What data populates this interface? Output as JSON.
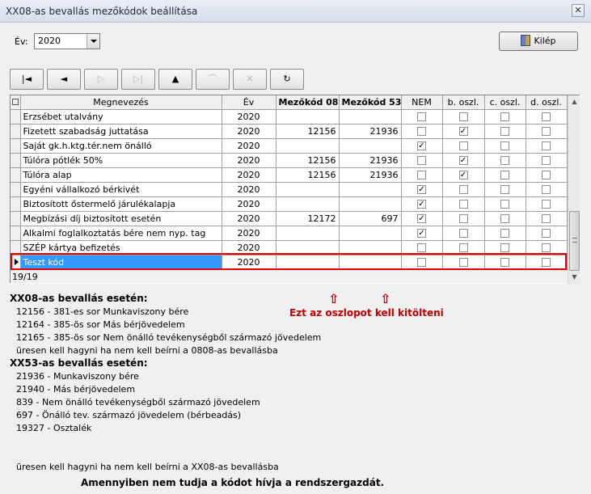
{
  "window": {
    "title": "XX08-as bevallás mezőkódok beállítása",
    "close": "✕"
  },
  "year": {
    "label": "Év:",
    "value": "2020"
  },
  "exit_label": "Kilép",
  "nav": {
    "first": "|◄",
    "prev": "◄",
    "next": "▷",
    "last": "▷|",
    "insert": "▲",
    "edit": "⌒",
    "cancel": "✕",
    "refresh": "↻"
  },
  "table": {
    "headers": [
      "Megnevezés",
      "Év",
      "Mezőkód 08",
      "Mezőkód 53",
      "NEM",
      "b. oszl.",
      "c. oszl.",
      "d. oszl."
    ],
    "rows": [
      {
        "name": "Erzsébet utalvány",
        "year": "2020",
        "c08": "",
        "c53": "",
        "nem": "",
        "b": "",
        "c": "",
        "d": ""
      },
      {
        "name": "Fizetett szabadság juttatása",
        "year": "2020",
        "c08": "12156",
        "c53": "21936",
        "nem": "",
        "b": "✓",
        "c": "",
        "d": ""
      },
      {
        "name": "Saját gk.h.ktg.tér.nem önálló",
        "year": "2020",
        "c08": "",
        "c53": "",
        "nem": "✓",
        "b": "",
        "c": "",
        "d": ""
      },
      {
        "name": "Túlóra pótlék 50%",
        "year": "2020",
        "c08": "12156",
        "c53": "21936",
        "nem": "",
        "b": "✓",
        "c": "",
        "d": ""
      },
      {
        "name": "Túlóra alap",
        "year": "2020",
        "c08": "12156",
        "c53": "21936",
        "nem": "",
        "b": "✓",
        "c": "",
        "d": ""
      },
      {
        "name": "Egyéni vállalkozó bérkivét",
        "year": "2020",
        "c08": "",
        "c53": "",
        "nem": "✓",
        "b": "",
        "c": "",
        "d": ""
      },
      {
        "name": "Biztosított őstermelő járulékalapja",
        "year": "2020",
        "c08": "",
        "c53": "",
        "nem": "✓",
        "b": "",
        "c": "",
        "d": ""
      },
      {
        "name": "Megbízási díj biztosított esetén",
        "year": "2020",
        "c08": "12172",
        "c53": "697",
        "nem": "✓",
        "b": "",
        "c": "",
        "d": ""
      },
      {
        "name": "Alkalmi foglalkoztatás bére nem nyp. tag",
        "year": "2020",
        "c08": "",
        "c53": "",
        "nem": "✓",
        "b": "",
        "c": "",
        "d": ""
      },
      {
        "name": "SZÉP kártya befizetés",
        "year": "2020",
        "c08": "",
        "c53": "",
        "nem": "",
        "b": "",
        "c": "",
        "d": ""
      },
      {
        "name": "Teszt kód",
        "year": "2020",
        "c08": "",
        "c53": "",
        "nem": "",
        "b": "",
        "c": "",
        "d": ""
      }
    ],
    "status": "19/19"
  },
  "annotation": {
    "arrow": "⇧",
    "text": "Ezt az oszlopot kell kitölteni"
  },
  "info08": {
    "heading": "XX08-as bevallás esetén:",
    "lines": [
      "12156 - 381-es sor Munkaviszony bére",
      "12164 - 385-ös sor Más bérjövedelem",
      "12165 - 385-ös sor Nem önálló tevékenységből származó jövedelem",
      "üresen kell hagyni ha nem kell beírni a 0808-as bevallásba"
    ]
  },
  "info53": {
    "heading": "XX53-as bevallás esetén:",
    "lines": [
      "21936 - Munkaviszony bére",
      "21940 - Más bérjövedelem",
      "839 - Nem önálló tevékenységből származó jövedelem",
      "697 - Önálló tev. származó jövedelem (bérbeadás)",
      "19327 - Osztalék"
    ],
    "empty_note": "üresen kell hagyni ha nem kell beírni a XX08-as bevallásba"
  },
  "footer": "Amennyiben nem tudja a kódot hívja a rendszergazdát."
}
